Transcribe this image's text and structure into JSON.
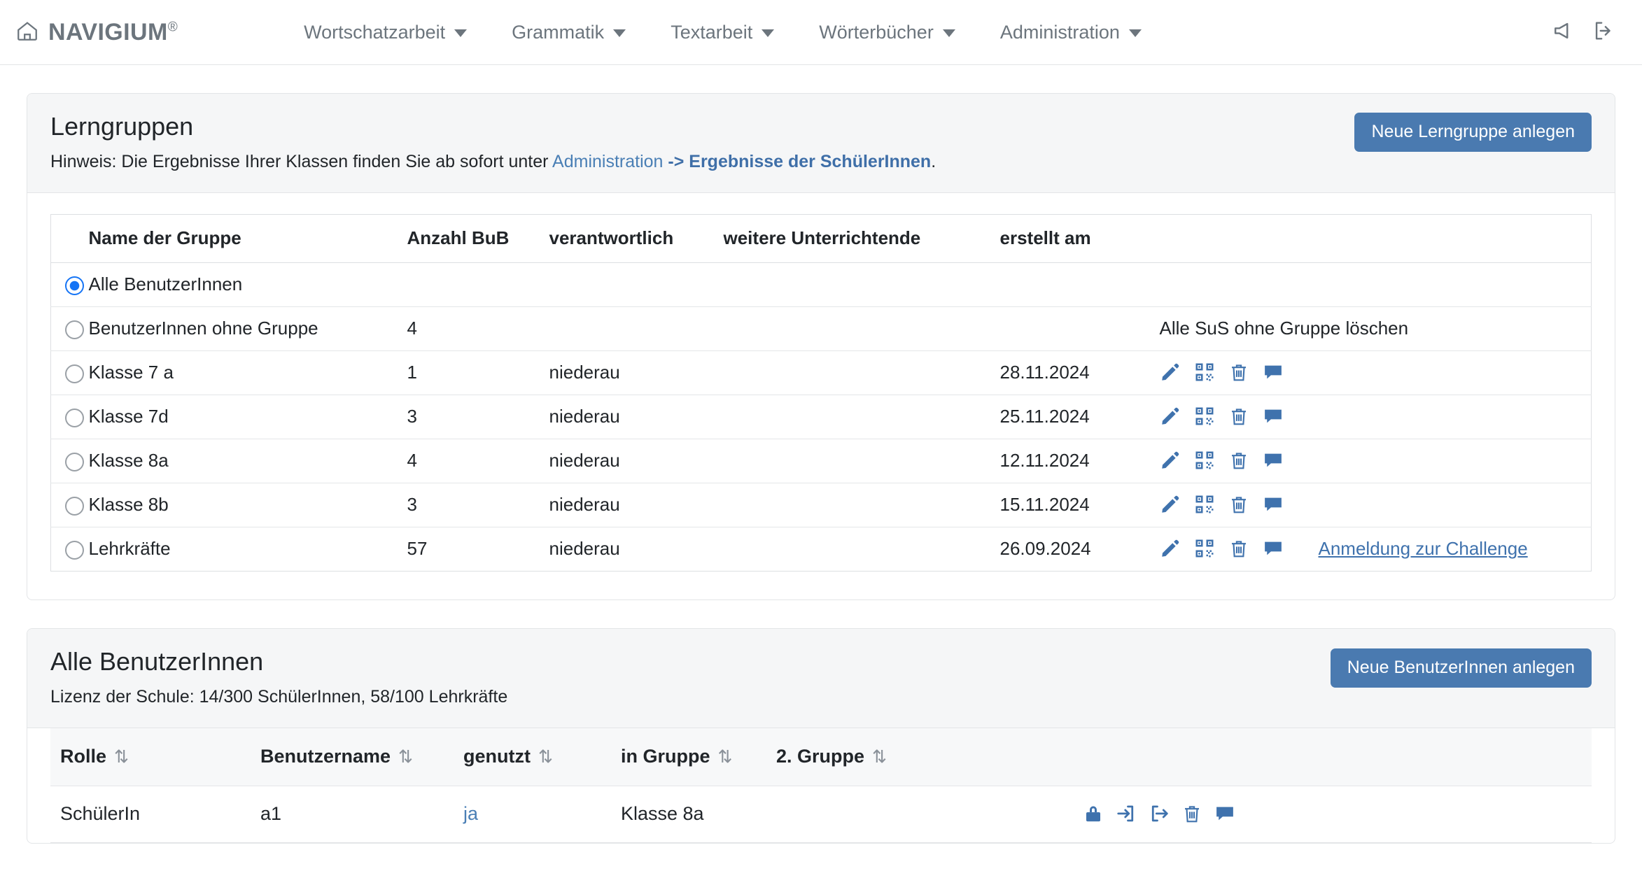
{
  "navbar": {
    "home_icon": "home-icon",
    "brand": "NAVIGIUM",
    "brand_mark": "®",
    "items": [
      {
        "label": "Wortschatzarbeit"
      },
      {
        "label": "Grammatik"
      },
      {
        "label": "Textarbeit"
      },
      {
        "label": "Wörterbücher"
      },
      {
        "label": "Administration"
      }
    ],
    "right_icons": [
      {
        "name": "megaphone-icon"
      },
      {
        "name": "logout-icon"
      }
    ]
  },
  "groups_panel": {
    "title": "Lerngruppen",
    "hint_prefix": "Hinweis: Die Ergebnisse Ihrer Klassen finden Sie ab sofort unter ",
    "hint_link": "Administration",
    "hint_link_strong": " -> Ergebnisse der SchülerInnen",
    "hint_suffix": ".",
    "new_group_button": "Neue Lerngruppe anlegen",
    "columns": [
      "Name der Gruppe",
      "Anzahl BuB",
      "verantwortlich",
      "weitere Unterrichtende",
      "erstellt am"
    ],
    "rows": [
      {
        "selected": true,
        "name": "Alle BenutzerInnen",
        "count": "",
        "responsible": "",
        "more_teachers": "",
        "created": "",
        "icons": [],
        "extra_text": "",
        "plain_action": ""
      },
      {
        "selected": false,
        "name": "BenutzerInnen ohne Gruppe",
        "count": "4",
        "responsible": "",
        "more_teachers": "",
        "created": "",
        "icons": [],
        "extra_text": "",
        "plain_action": "Alle SuS ohne Gruppe löschen"
      },
      {
        "selected": false,
        "name": "Klasse 7 a",
        "count": "1",
        "responsible": "niederau",
        "more_teachers": "",
        "created": "28.11.2024",
        "icons": [
          "pencil-icon",
          "qrcode-icon",
          "trash-icon",
          "comment-icon"
        ],
        "extra_text": "",
        "plain_action": ""
      },
      {
        "selected": false,
        "name": "Klasse 7d",
        "count": "3",
        "responsible": "niederau",
        "more_teachers": "",
        "created": "25.11.2024",
        "icons": [
          "pencil-icon",
          "qrcode-icon",
          "trash-icon",
          "comment-icon"
        ],
        "extra_text": "",
        "plain_action": ""
      },
      {
        "selected": false,
        "name": "Klasse 8a",
        "count": "4",
        "responsible": "niederau",
        "more_teachers": "",
        "created": "12.11.2024",
        "icons": [
          "pencil-icon",
          "qrcode-icon",
          "trash-icon",
          "comment-icon"
        ],
        "extra_text": "",
        "plain_action": ""
      },
      {
        "selected": false,
        "name": "Klasse 8b",
        "count": "3",
        "responsible": "niederau",
        "more_teachers": "",
        "created": "15.11.2024",
        "icons": [
          "pencil-icon",
          "qrcode-icon",
          "trash-icon",
          "comment-icon"
        ],
        "extra_text": "",
        "plain_action": ""
      },
      {
        "selected": false,
        "name": "Lehrkräfte",
        "count": "57",
        "responsible": "niederau",
        "more_teachers": "",
        "created": "26.09.2024",
        "icons": [
          "pencil-icon",
          "qrcode-icon",
          "trash-icon",
          "comment-icon"
        ],
        "extra_text": "Anmeldung zur Challenge",
        "plain_action": ""
      }
    ]
  },
  "users_panel": {
    "title": "Alle BenutzerInnen",
    "license": "Lizenz der Schule: 14/300 SchülerInnen, 58/100 Lehrkräfte",
    "new_user_button": "Neue BenutzerInnen anlegen",
    "sort_glyph": "⇅",
    "columns": [
      "Rolle",
      "Benutzername",
      "genutzt",
      "in Gruppe",
      "2. Gruppe"
    ],
    "rows": [
      {
        "role": "SchülerIn",
        "username": "a1",
        "used": "ja",
        "group1": "Klasse 8a",
        "group2": "",
        "icons": [
          "lock-icon",
          "login-icon",
          "logout-icon",
          "trash-icon",
          "comment-icon"
        ]
      }
    ]
  },
  "colors": {
    "accent": "#4a7ab0",
    "link": "#4a7fb5",
    "icon_blue": "#3f72ad",
    "radio_checked": "#1574f5",
    "panel_header_bg": "#f5f6f7",
    "muted_text": "#6c757d"
  }
}
